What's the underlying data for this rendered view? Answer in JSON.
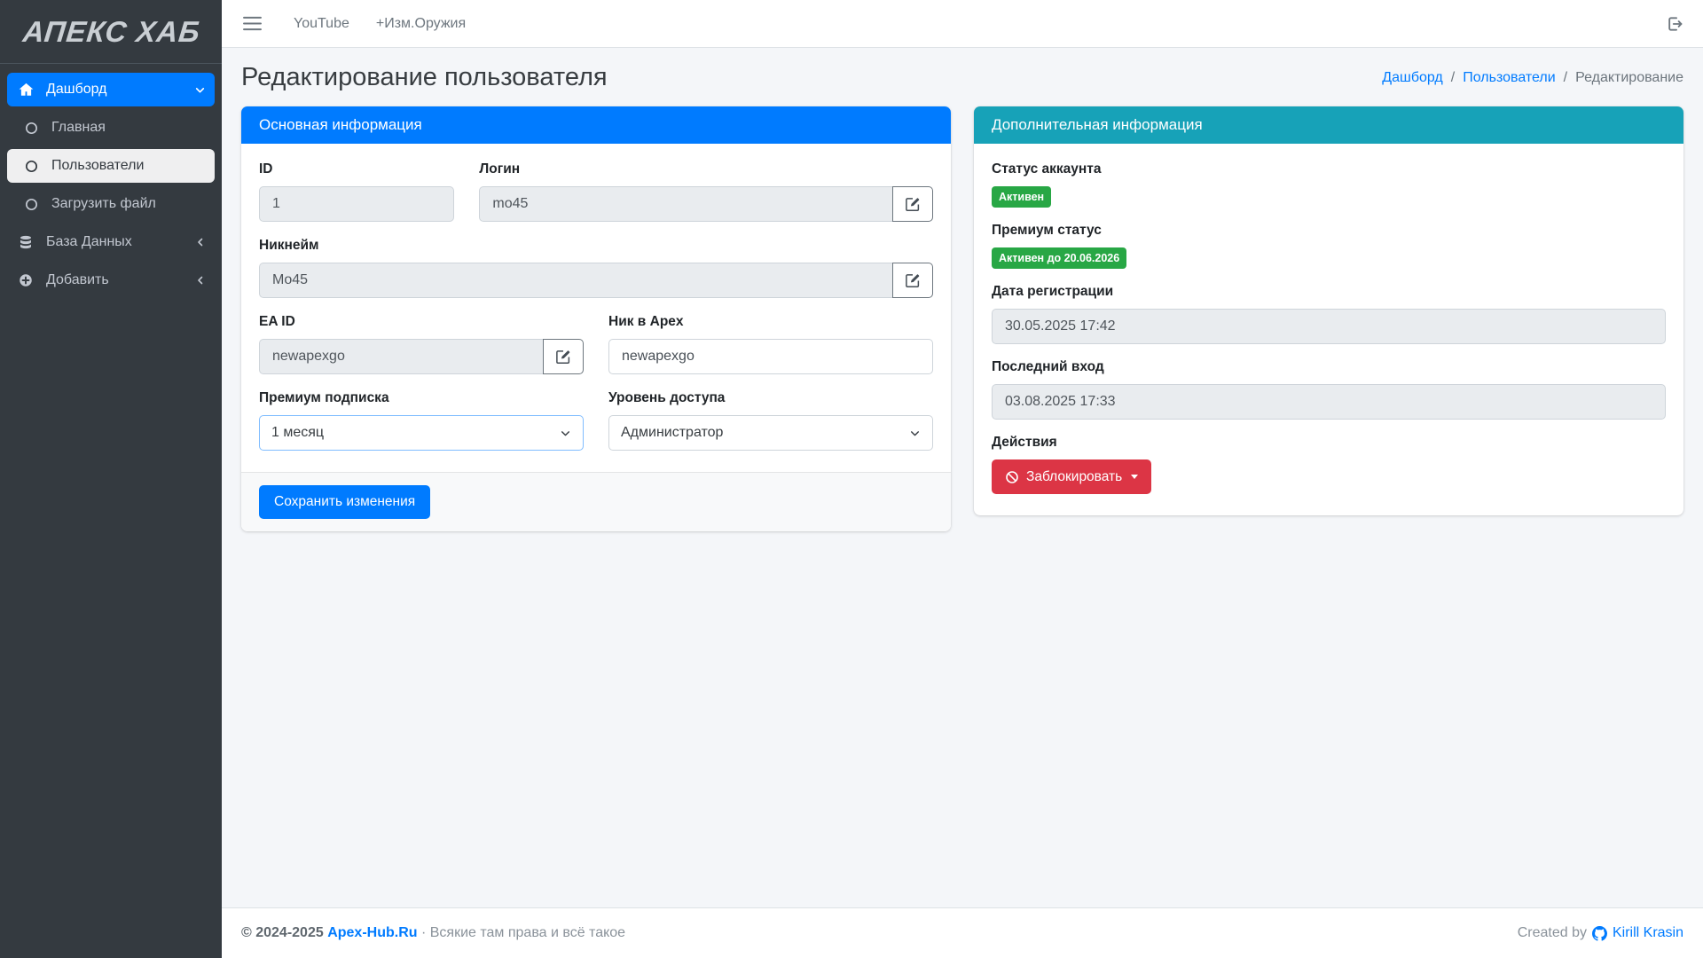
{
  "brand": {
    "title": "АПЕКС ХАБ"
  },
  "navbar": {
    "links": [
      {
        "label": "YouTube"
      },
      {
        "label": "+Изм.Оружия"
      }
    ]
  },
  "sidebar": {
    "items": [
      {
        "label": "Дашборд",
        "icon": "home-icon",
        "state": "active-parent"
      },
      {
        "label": "Главная",
        "icon": "circle-icon"
      },
      {
        "label": "Пользователи",
        "icon": "circle-icon",
        "state": "active"
      },
      {
        "label": "Загрузить файл",
        "icon": "circle-icon"
      },
      {
        "label": "База Данных",
        "icon": "database-icon"
      },
      {
        "label": "Добавить",
        "icon": "plus-circle-icon"
      }
    ]
  },
  "page": {
    "title": "Редактирование пользователя",
    "breadcrumb": [
      "Дашборд",
      "Пользователи",
      "Редактирование"
    ],
    "separator": "/"
  },
  "main_card": {
    "title": "Основная информация",
    "fields": {
      "id": {
        "label": "ID",
        "value": "1"
      },
      "login": {
        "label": "Логин",
        "value": "mo45"
      },
      "nickname": {
        "label": "Никнейм",
        "value": "Mo45"
      },
      "ea_id": {
        "label": "EA ID",
        "value": "newapexgo"
      },
      "apex_nick": {
        "label": "Ник в Apex",
        "value": "newapexgo"
      },
      "premium": {
        "label": "Премиум подписка",
        "value": "1 месяц"
      },
      "access": {
        "label": "Уровень доступа",
        "value": "Администратор"
      }
    },
    "save_label": "Сохранить изменения"
  },
  "info_card": {
    "title": "Дополнительная информация",
    "account_status_label": "Статус аккаунта",
    "account_status_badge": "Активен",
    "premium_status_label": "Премиум статус",
    "premium_status_badge": "Активен до 20.06.2026",
    "reg_date_label": "Дата регистрации",
    "reg_date_value": "30.05.2025 17:42",
    "last_login_label": "Последний вход",
    "last_login_value": "03.08.2025 17:33",
    "actions_label": "Действия",
    "block_button": "Заблокировать"
  },
  "footer": {
    "copyright": "© 2024-2025",
    "site": "Apex-Hub.Ru",
    "tagline": "· Всякие там права и всё такое",
    "created_by": "Created by",
    "author": "Kirill Krasin"
  },
  "colors": {
    "primary": "#007bff",
    "info": "#17a2b8",
    "success": "#28a745",
    "danger": "#dc3545",
    "sidebar_bg": "#343a40",
    "content_bg": "#f4f6f9"
  },
  "icons": [
    "menu-icon",
    "home-icon",
    "circle-icon",
    "database-icon",
    "plus-circle-icon",
    "chevron-down-icon",
    "chevron-left-icon",
    "logout-icon",
    "edit-icon",
    "ban-icon",
    "caret-down-icon",
    "github-icon"
  ]
}
